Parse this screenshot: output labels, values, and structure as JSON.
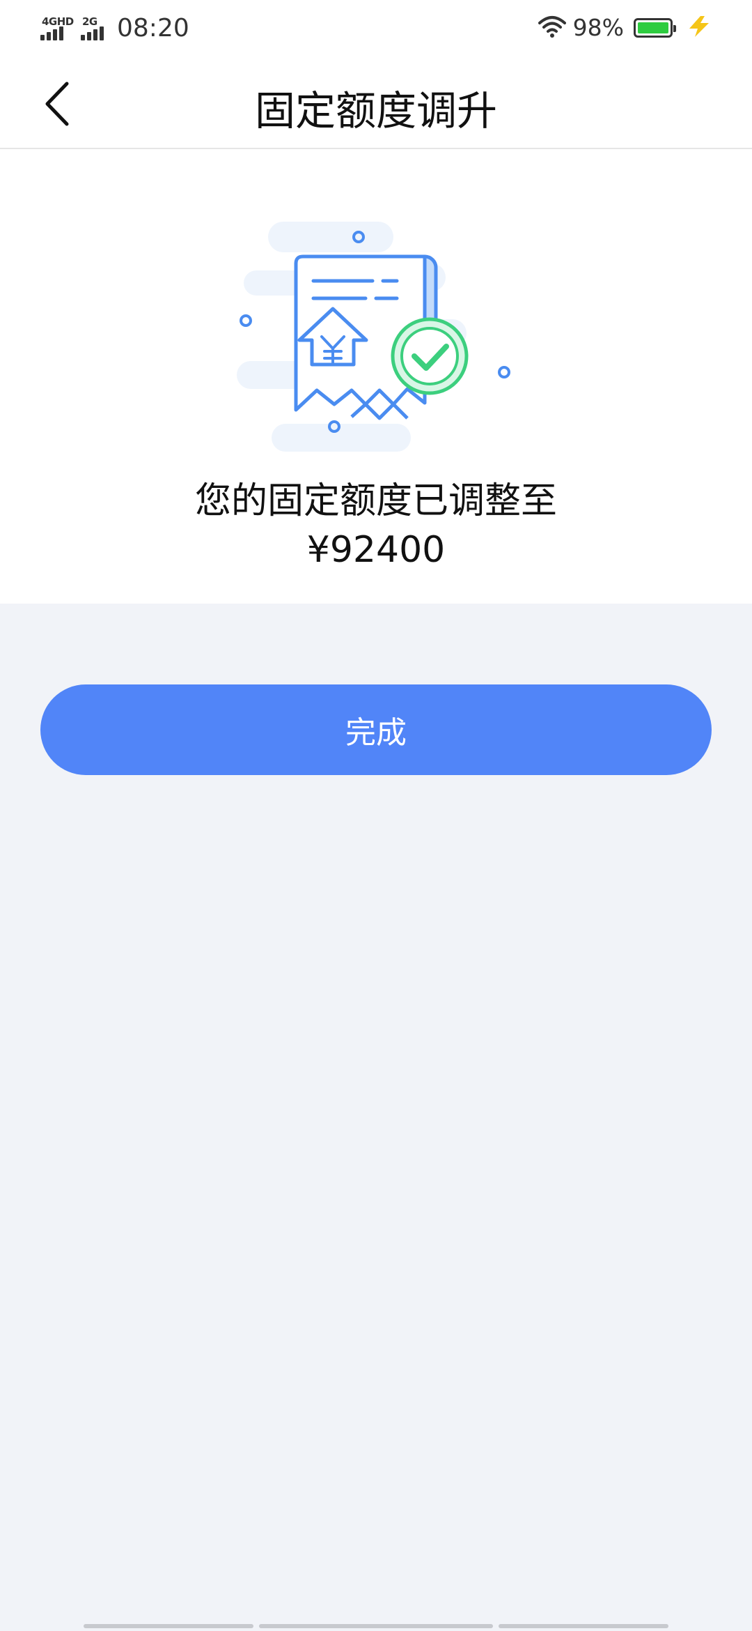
{
  "status_bar": {
    "network_1": "4GHD",
    "network_2": "2G",
    "time": "08:20",
    "battery_percent": "98%",
    "battery_level": 0.98,
    "icons": [
      "signal-icon",
      "wifi-icon",
      "battery-icon",
      "charging-icon"
    ]
  },
  "navbar": {
    "title": "固定额度调升",
    "back_icon": "chevron-left-icon"
  },
  "result": {
    "illustration_icon": "receipt-check-icon",
    "message": "您的固定额度已调整至",
    "amount": "¥92400"
  },
  "actions": {
    "done_label": "完成"
  },
  "colors": {
    "primary": "#5185f8",
    "background": "#f1f3f8",
    "success": "#3ccf7e",
    "illustration_blue": "#4a8cf0"
  }
}
